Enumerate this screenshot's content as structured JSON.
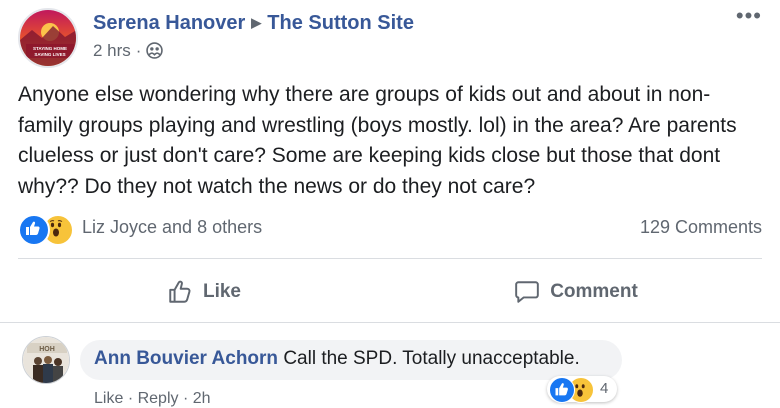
{
  "post": {
    "author": "Serena Hanover",
    "group": "The Sutton Site",
    "time": "2 hrs",
    "more_label": "•••",
    "avatar_text_line1": "STAYING HOME",
    "avatar_text_line2": "SAVING LIVES",
    "body": "Anyone else wondering why there are groups of kids out and about in non-family groups playing and wrestling (boys mostly. lol) in the area? Are parents clueless or just don't care? Some are keeping kids close but those that dont why?? Do they not watch the news or do they not care?"
  },
  "reactions": {
    "summary": "Liz Joyce and 8 others",
    "comments_count": "129 Comments",
    "types": [
      "like",
      "wow"
    ]
  },
  "actions": {
    "like_label": "Like",
    "comment_label": "Comment"
  },
  "comment": {
    "author": "Ann Bouvier Achorn",
    "text": "Call the SPD. Totally unacceptable.",
    "reaction_count": "4",
    "like_link": "Like",
    "reply_link": "Reply",
    "time": "2h",
    "avatar_label": "HOH"
  },
  "colors": {
    "link_blue": "#385898",
    "like_blue": "#1877f2",
    "wow_yellow": "#f7c33a",
    "muted_gray": "#606770"
  }
}
